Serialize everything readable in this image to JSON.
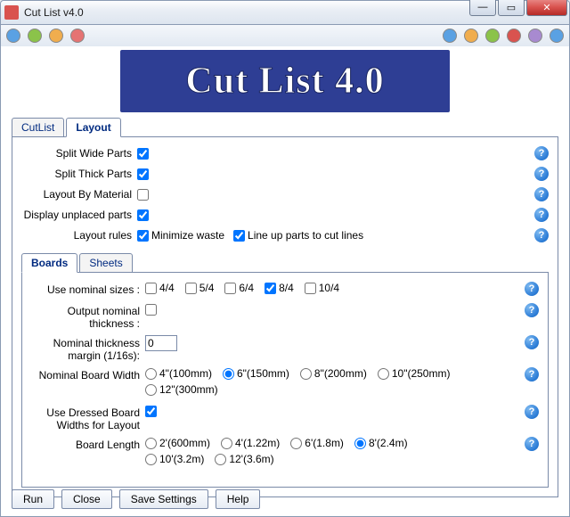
{
  "window": {
    "title": "Cut List v4.0"
  },
  "banner": {
    "text": "Cut List 4.0"
  },
  "tabs": {
    "cutlist": "CutList",
    "layout": "Layout",
    "active": "layout"
  },
  "layout_options": {
    "split_wide_label": "Split Wide Parts",
    "split_wide_checked": true,
    "split_thick_label": "Split Thick Parts",
    "split_thick_checked": true,
    "by_material_label": "Layout By Material",
    "by_material_checked": false,
    "display_unplaced_label": "Display unplaced parts",
    "display_unplaced_checked": true,
    "layout_rules_label": "Layout rules",
    "rule_minimize_label": "Minimize waste",
    "rule_minimize_checked": true,
    "rule_lineup_label": "Line up parts to cut lines",
    "rule_lineup_checked": true
  },
  "inner_tabs": {
    "boards": "Boards",
    "sheets": "Sheets",
    "active": "boards"
  },
  "boards": {
    "nominal_sizes_label": "Use nominal sizes :",
    "nominal_sizes": [
      {
        "label": "4/4",
        "checked": false
      },
      {
        "label": "5/4",
        "checked": false
      },
      {
        "label": "6/4",
        "checked": false
      },
      {
        "label": "8/4",
        "checked": true
      },
      {
        "label": "10/4",
        "checked": false
      }
    ],
    "output_nominal_label": "Output nominal thickness :",
    "output_nominal_checked": false,
    "thickness_margin_label": "Nominal thickness margin (1/16s):",
    "thickness_margin_value": "0",
    "board_width_label": "Nominal Board Width",
    "board_widths": [
      {
        "label": "4\"(100mm)",
        "selected": false
      },
      {
        "label": "6\"(150mm)",
        "selected": true
      },
      {
        "label": "8\"(200mm)",
        "selected": false
      },
      {
        "label": "10\"(250mm)",
        "selected": false
      },
      {
        "label": "12\"(300mm)",
        "selected": false
      }
    ],
    "dressed_widths_label": "Use Dressed Board Widths for Layout",
    "dressed_widths_checked": true,
    "board_length_label": "Board Length",
    "board_lengths": [
      {
        "label": "2'(600mm)",
        "selected": false
      },
      {
        "label": "4'(1.22m)",
        "selected": false
      },
      {
        "label": "6'(1.8m)",
        "selected": false
      },
      {
        "label": "8'(2.4m)",
        "selected": true
      },
      {
        "label": "10'(3.2m)",
        "selected": false
      },
      {
        "label": "12'(3.6m)",
        "selected": false
      }
    ]
  },
  "buttons": {
    "run": "Run",
    "close": "Close",
    "save": "Save Settings",
    "help": "Help"
  },
  "help_icon_char": "?"
}
